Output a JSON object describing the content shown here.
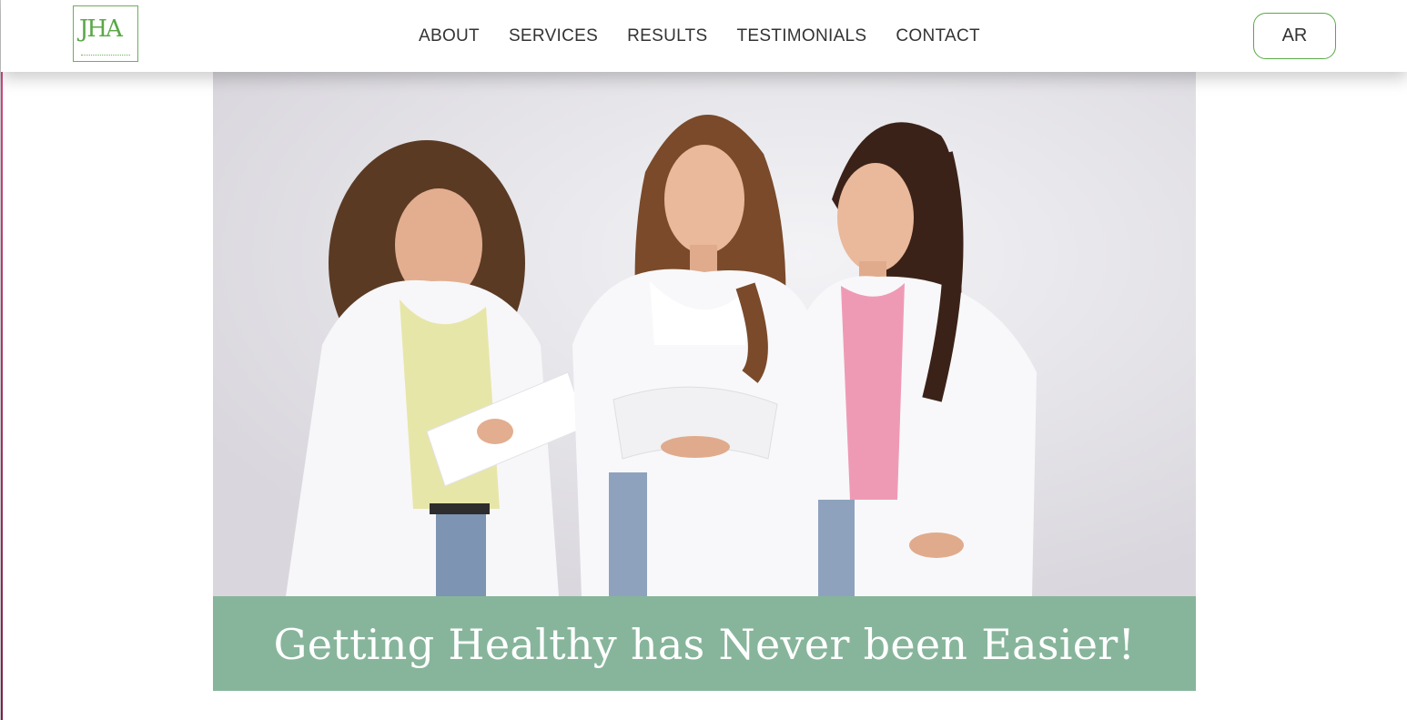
{
  "header": {
    "logo": {
      "letters": "JHA",
      "accent_color": "#5aa847"
    },
    "nav": [
      {
        "label": "ABOUT"
      },
      {
        "label": "SERVICES"
      },
      {
        "label": "RESULTS"
      },
      {
        "label": "TESTIMONIALS"
      },
      {
        "label": "CONTACT"
      }
    ],
    "language_button": "AR"
  },
  "hero": {
    "image_icon": "three-nutritionists-photo",
    "caption": "Getting Healthy has Never been Easier!",
    "caption_bg": "#87b59b"
  }
}
